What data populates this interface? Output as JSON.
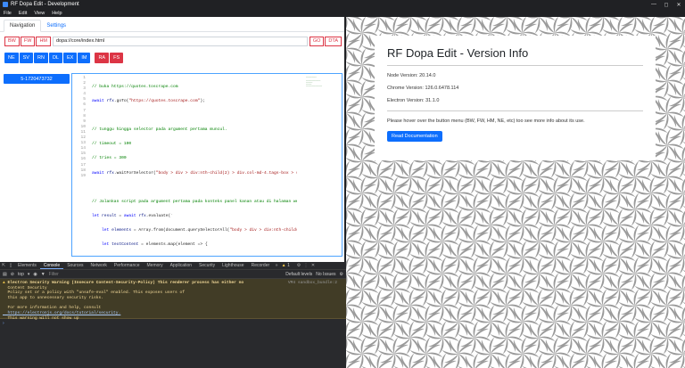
{
  "window": {
    "title": "RF Dopa Edit - Development"
  },
  "menu": [
    "File",
    "Edit",
    "View",
    "Help"
  ],
  "tabs": {
    "navigation": "Navigation",
    "settings": "Settings"
  },
  "pathbar": {
    "bw": "BW",
    "fw": "FW",
    "hm": "HM",
    "path": "dopa://core/index.html",
    "go": "GO",
    "dta": "DTA"
  },
  "nav_buttons": {
    "ne": "NE",
    "sv": "SV",
    "rn": "RN",
    "dl": "DL",
    "ex": "EX",
    "im": "IM",
    "ra": "RA",
    "fs": "FS"
  },
  "side_item": "5-1720473732",
  "editor": {
    "line_numbers": [
      "1",
      "2",
      "3",
      "4",
      "5",
      "6",
      "7",
      "8",
      "9",
      "10",
      "11",
      "12",
      "13",
      "14",
      "15",
      "16",
      "17",
      "18",
      "19"
    ]
  },
  "devtools": {
    "tabs": [
      "Elements",
      "Console",
      "Sources",
      "Network",
      "Performance",
      "Memory",
      "Application",
      "Security",
      "Lighthouse",
      "Recorder"
    ],
    "warn_count": "1",
    "context": "top",
    "filter": "Filter",
    "levels": "Default levels",
    "issues": "No Issues",
    "warning_lines": [
      "Electron Security Warning (Insecure Content-Security-Policy) This renderer process has either no",
      "  Content Security",
      "  Policy set or a policy with \"unsafe-eval\" enabled. This exposes users of",
      "  this app to unnecessary security risks.",
      "",
      "  For more information and help, consult",
      "  https://electronjs.org/docs/tutorial/security.",
      "  This warning will not show up",
      "  once the app is packaged."
    ],
    "warning_source": "VM4 sandbox_bundle:2"
  },
  "info_card": {
    "title": "RF Dopa Edit - Version Info",
    "node": "Node Version: 20.14.0",
    "chrome": "Chrome Version: 126.0.6478.114",
    "electron": "Electron Version: 31.1.0",
    "hint": "Please hover over the button menu (BW, FW, HM, NE, etc) too see more info about its use.",
    "button": "Read Documentation"
  },
  "colors": {
    "primary": "#0d6efd",
    "danger": "#dc3545",
    "devtools_bg": "#292a2d",
    "warning_bg": "#413c26"
  }
}
